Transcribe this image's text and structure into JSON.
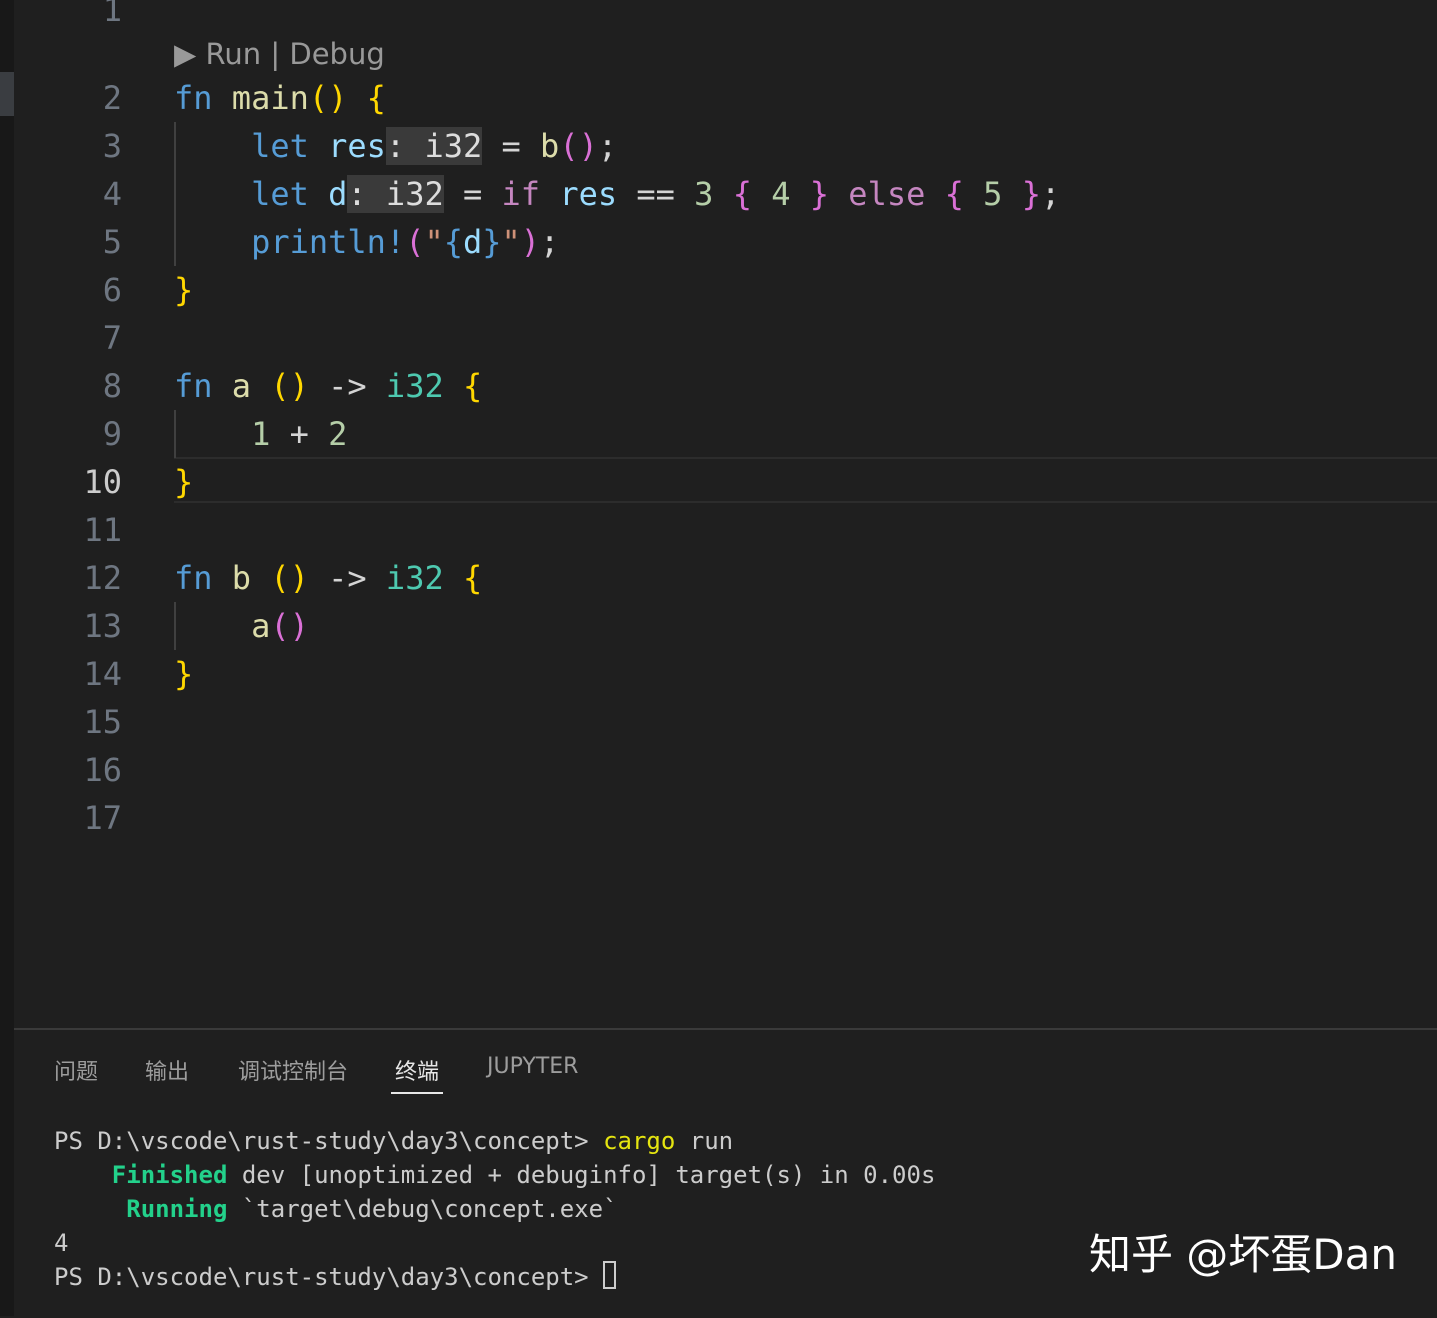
{
  "editor": {
    "line_numbers": [
      "1",
      "2",
      "3",
      "4",
      "5",
      "6",
      "7",
      "8",
      "9",
      "10",
      "11",
      "12",
      "13",
      "14",
      "15",
      "16",
      "17"
    ],
    "active_line": "10",
    "codelens": {
      "run": "Run",
      "separator": "|",
      "debug": "Debug",
      "run_icon": "play-icon"
    },
    "code": {
      "l2": {
        "fn_kw": "fn",
        "name": "main",
        "parens": "()",
        "brace": "{"
      },
      "l3": {
        "let_kw": "let",
        "var": "res",
        "hint": ": i32",
        "eq": "=",
        "call": "b",
        "parens": "()",
        "semi": ";"
      },
      "l4": {
        "let_kw": "let",
        "var": "d",
        "hint": ": i32",
        "eq": "=",
        "if_kw": "if",
        "cond_var": "res",
        "op": "==",
        "n3": "3",
        "open1": "{",
        "n4": "4",
        "close1": "}",
        "else_kw": "else",
        "open2": "{",
        "n5": "5",
        "close2": "}",
        "semi": ";"
      },
      "l5": {
        "macro": "println!",
        "open": "(",
        "str_q1": "\"",
        "fmt_open": "{",
        "fmt_var": "d",
        "fmt_close": "}",
        "str_q2": "\"",
        "close": ")",
        "semi": ";"
      },
      "l6": {
        "brace": "}"
      },
      "l8": {
        "fn_kw": "fn",
        "name": "a",
        "parens": "()",
        "arrow": "->",
        "type": "i32",
        "brace": "{"
      },
      "l9": {
        "n1": "1",
        "plus": "+",
        "n2": "2"
      },
      "l10": {
        "brace": "}"
      },
      "l12": {
        "fn_kw": "fn",
        "name": "b",
        "parens": "()",
        "arrow": "->",
        "type": "i32",
        "brace": "{"
      },
      "l13": {
        "call": "a",
        "parens": "()"
      },
      "l14": {
        "brace": "}"
      }
    }
  },
  "panel": {
    "tabs": [
      "问题",
      "输出",
      "调试控制台",
      "终端",
      "JUPYTER"
    ],
    "active_tab": "终端",
    "terminal": {
      "prompt1": "PS D:\\vscode\\rust-study\\day3\\concept> ",
      "cmd_cargo": "cargo",
      "cmd_run": " run",
      "finished_label": "Finished",
      "finished_text": " dev [unoptimized + debuginfo] target(s) in 0.00s",
      "running_label": "Running",
      "running_text": " `target\\debug\\concept.exe`",
      "output": "4",
      "prompt2": "PS D:\\vscode\\rust-study\\day3\\concept> "
    }
  },
  "watermark": "知乎 @坏蛋Dan"
}
